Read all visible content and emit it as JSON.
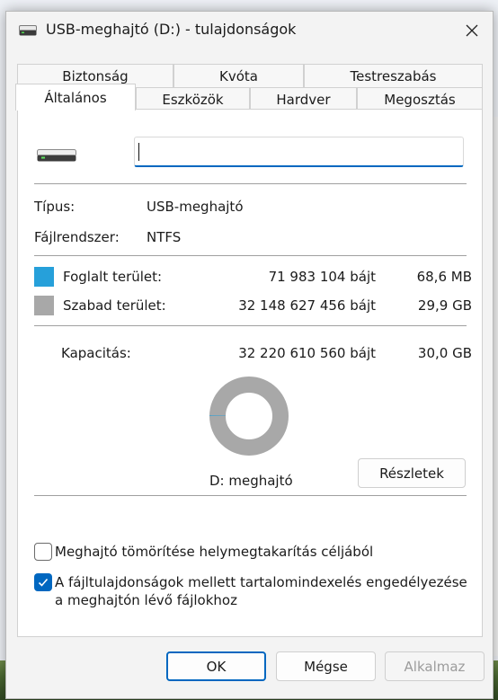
{
  "window": {
    "title": "USB-meghajtó (D:) - tulajdonságok"
  },
  "tabs_back": [
    "Biztonság",
    "Kvóta",
    "Testreszabás"
  ],
  "tabs_front": [
    "Általános",
    "Eszközök",
    "Hardver",
    "Megosztás"
  ],
  "general": {
    "name_value": "",
    "type_label": "Típus:",
    "type_value": "USB-meghajtó",
    "fs_label": "Fájlrendszer:",
    "fs_value": "NTFS",
    "used_label": "Foglalt terület:",
    "used_bytes": "71 983 104 bájt",
    "used_size": "68,6 MB",
    "free_label": "Szabad terület:",
    "free_bytes": "32 148 627 456 bájt",
    "free_size": "29,9 GB",
    "capacity_label": "Kapacitás:",
    "capacity_bytes": "32 220 610 560 bájt",
    "capacity_size": "30,0 GB",
    "drive_label": "D: meghajtó",
    "details_button": "Részletek",
    "used_fraction": 0.0022,
    "used_color": "#26a0da",
    "free_color": "#a8a8a8"
  },
  "options": {
    "compress_label": "Meghajtó tömörítése helymegtakarítás céljából",
    "compress_checked": false,
    "index_label": "A fájltulajdonságok mellett tartalomindexelés engedélyezése a meghajtón lévő fájlokhoz",
    "index_checked": true
  },
  "footer": {
    "ok": "OK",
    "cancel": "Mégse",
    "apply": "Alkalmaz"
  },
  "icons": {
    "title": "drive-icon",
    "close": "close-icon",
    "drive": "usb-drive-icon",
    "check": "checkmark-icon"
  }
}
